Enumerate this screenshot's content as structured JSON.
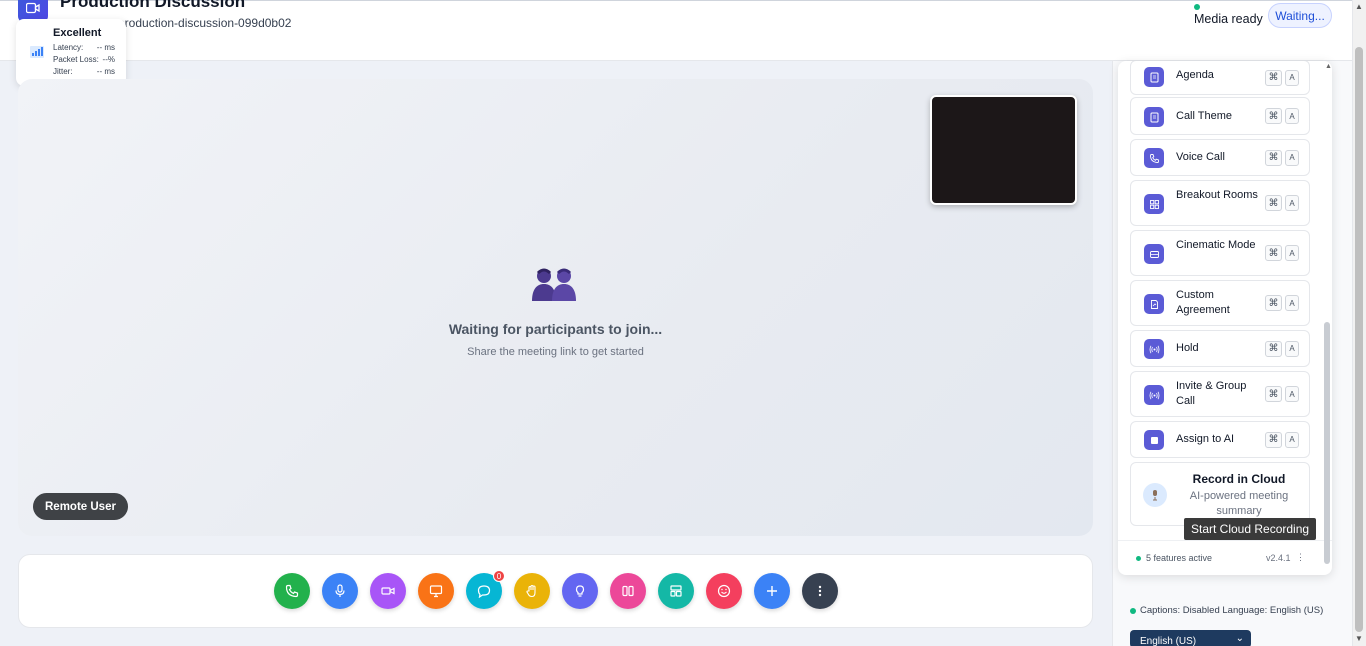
{
  "header": {
    "title": "Production Discussion",
    "meeting_id": "production-discussion-099d0b02",
    "media_status": "Media ready",
    "waiting_label": "Waiting..."
  },
  "network": {
    "quality": "Excellent",
    "latency_label": "Latency:",
    "latency_value": "-- ms",
    "packet_loss_label": "Packet Loss:",
    "packet_loss_value": "--%",
    "jitter_label": "Jitter:",
    "jitter_value": "-- ms"
  },
  "stage": {
    "waiting_title": "Waiting for participants to join...",
    "waiting_subtitle": "Share the meeting link to get started",
    "remote_user_label": "Remote User"
  },
  "controls": {
    "chat_badge": "0",
    "buttons": [
      {
        "name": "phone",
        "color": "#22b14c"
      },
      {
        "name": "microphone",
        "color": "#3b82f6"
      },
      {
        "name": "video",
        "color": "#a855f7"
      },
      {
        "name": "screen-share",
        "color": "#f97316"
      },
      {
        "name": "chat",
        "color": "#06b6d4"
      },
      {
        "name": "raise-hand",
        "color": "#eab308"
      },
      {
        "name": "lightbulb",
        "color": "#6366f1"
      },
      {
        "name": "layout",
        "color": "#ec4899"
      },
      {
        "name": "whiteboard",
        "color": "#14b8a6"
      },
      {
        "name": "reactions",
        "color": "#f43f5e"
      },
      {
        "name": "add",
        "color": "#3b82f6"
      },
      {
        "name": "more",
        "color": "#374151"
      }
    ]
  },
  "features": {
    "items": [
      {
        "label": "Agenda",
        "cmd": "⌘",
        "key": "A",
        "icon": "document-icon"
      },
      {
        "label": "Call Theme",
        "cmd": "⌘",
        "key": "A",
        "icon": "document-icon"
      },
      {
        "label": "Voice Call",
        "cmd": "⌘",
        "key": "A",
        "icon": "phone-icon"
      },
      {
        "label": "Breakout Rooms",
        "cmd": "⌘",
        "key": "A",
        "icon": "grid-icon"
      },
      {
        "label": "Cinematic Mode",
        "cmd": "⌘",
        "key": "A",
        "icon": "film-icon"
      },
      {
        "label": "Custom Agreement",
        "cmd": "⌘",
        "key": "A",
        "icon": "agreement-icon"
      },
      {
        "label": "Hold",
        "cmd": "⌘",
        "key": "A",
        "icon": "broadcast-icon"
      },
      {
        "label": "Invite & Group Call",
        "cmd": "⌘",
        "key": "A",
        "icon": "broadcast-icon"
      },
      {
        "label": "Assign to AI",
        "cmd": "⌘",
        "key": "A",
        "icon": "square-icon"
      }
    ],
    "record": {
      "title": "Record in Cloud",
      "subtitle": "AI-powered meeting summary",
      "tooltip": "Start Cloud Recording"
    },
    "footer": {
      "active": "5 features active",
      "version": "v2.4.1",
      "more": "⋮"
    }
  },
  "captions": {
    "status": "Captions: Disabled  Language: English (US)",
    "selected_language": "English (US)"
  },
  "colors": {
    "accent": "#5b5bd6",
    "status_green": "#10b981",
    "pip_bg": "#1c1718"
  }
}
